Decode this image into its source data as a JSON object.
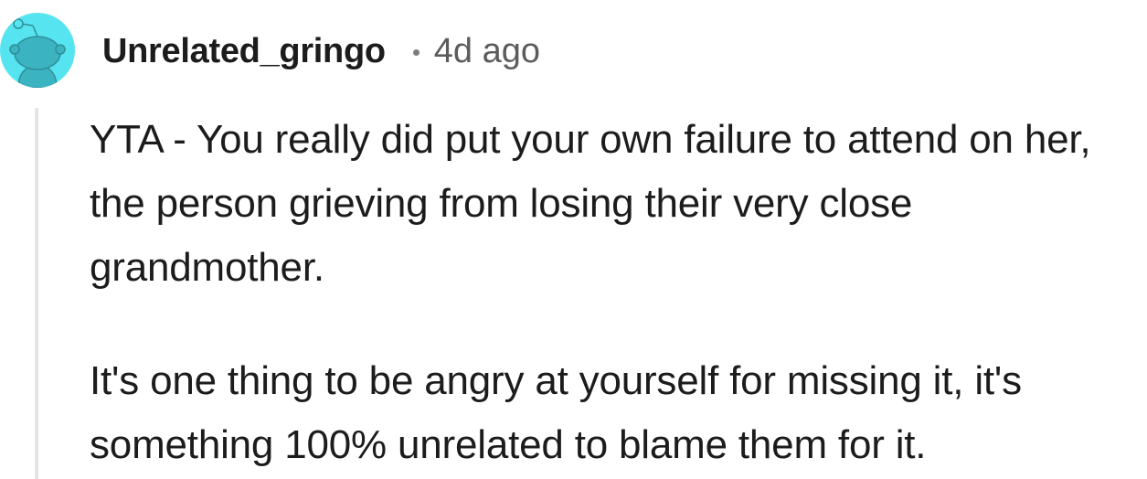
{
  "comment": {
    "author": "Unrelated_gringo",
    "separator": "•",
    "timestamp": "4d ago",
    "avatar_icon": "reddit-snoo-avatar-icon",
    "paragraphs": [
      "YTA - You really did put your own failure to attend on her, the person grieving from losing their very close grandmother.",
      "It's one thing to be angry at yourself for missing it, it's something 100% unrelated to blame them for it."
    ]
  },
  "colors": {
    "avatar_bg": "#56e4f0",
    "avatar_figure": "#3bb3c0",
    "username": "#1c1c1c",
    "timestamp": "#5c5c5c",
    "thread_line": "#e5e5e5",
    "body_text": "#1c1c1c"
  }
}
